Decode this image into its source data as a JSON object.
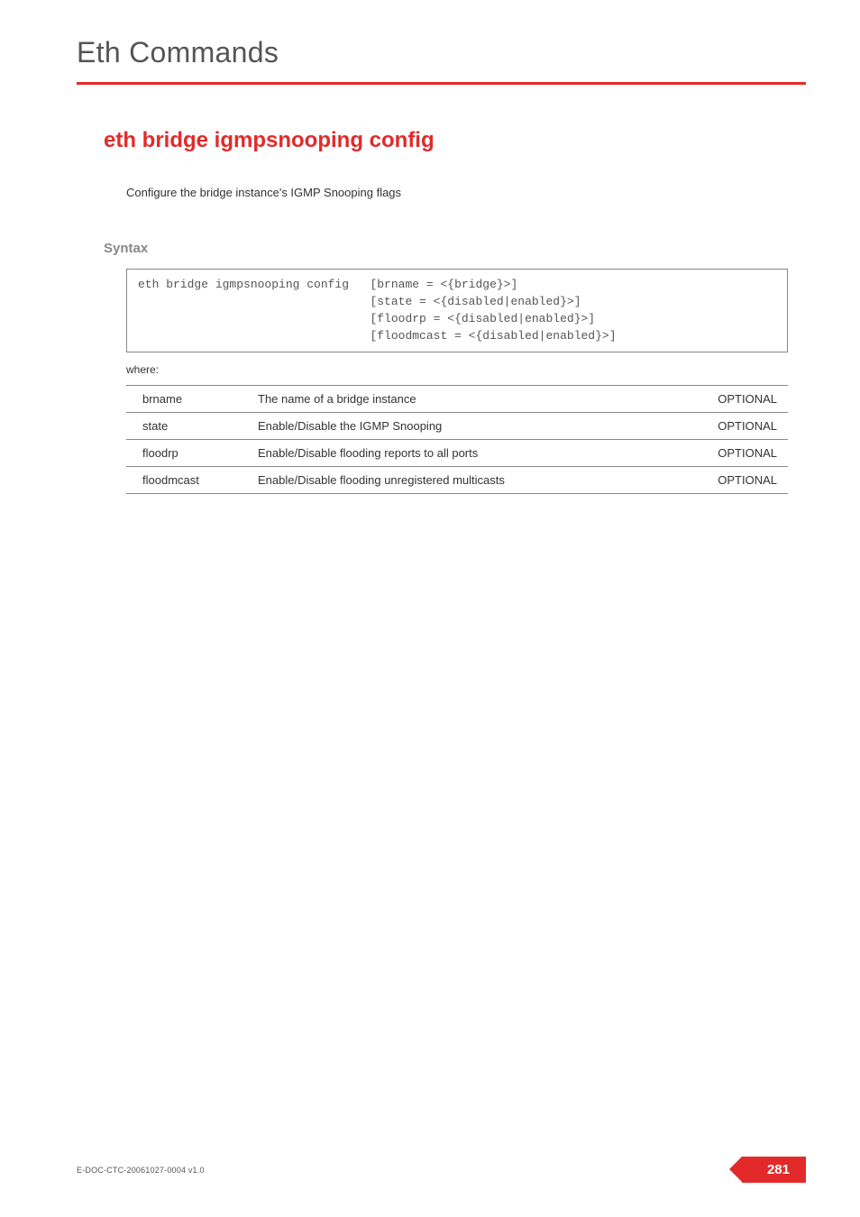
{
  "header": {
    "title": "Eth Commands"
  },
  "command": {
    "title": "eth bridge igmpsnooping config",
    "description": "Configure the bridge instance's IGMP Snooping flags"
  },
  "syntax": {
    "label": "Syntax",
    "command": "eth bridge igmpsnooping config",
    "args": "[brname = <{bridge}>]\n[state = <{disabled|enabled}>]\n[floodrp = <{disabled|enabled}>]\n[floodmcast = <{disabled|enabled}>]",
    "where_label": "where:"
  },
  "params": [
    {
      "name": "brname",
      "desc": "The name of a bridge instance",
      "opt": "OPTIONAL"
    },
    {
      "name": "state",
      "desc": "Enable/Disable the IGMP Snooping",
      "opt": "OPTIONAL"
    },
    {
      "name": "floodrp",
      "desc": "Enable/Disable flooding reports to all ports",
      "opt": "OPTIONAL"
    },
    {
      "name": "floodmcast",
      "desc": "Enable/Disable flooding unregistered multicasts",
      "opt": "OPTIONAL"
    }
  ],
  "footer": {
    "doc_id": "E-DOC-CTC-20061027-0004 v1.0",
    "page_number": "281"
  }
}
